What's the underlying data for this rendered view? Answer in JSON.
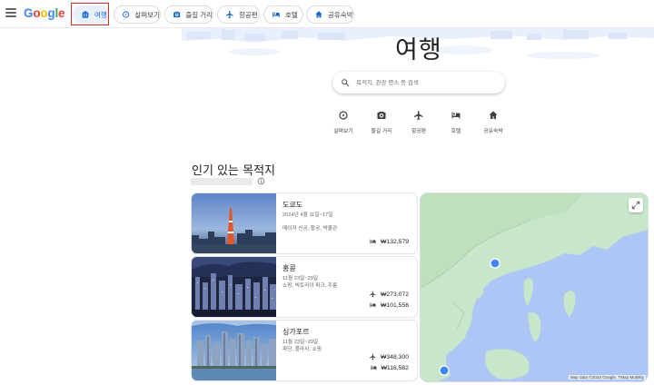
{
  "header": {
    "logo": [
      "G",
      "o",
      "o",
      "g",
      "l",
      "e"
    ],
    "tabs": [
      {
        "label": "여행",
        "icon": "suitcase-icon",
        "active": true
      },
      {
        "label": "살펴보기",
        "icon": "explore-icon",
        "active": false
      },
      {
        "label": "즐길 거리",
        "icon": "camera-icon",
        "active": false
      },
      {
        "label": "항공편",
        "icon": "flight-icon",
        "active": false
      },
      {
        "label": "호텔",
        "icon": "hotel-icon",
        "active": false
      },
      {
        "label": "공유숙박",
        "icon": "home-icon",
        "active": false
      }
    ]
  },
  "hero": {
    "title": "여행",
    "search_placeholder": "목적지, 관광 명소 등 검색",
    "quick_links": [
      {
        "label": "살펴보기",
        "icon": "explore-icon"
      },
      {
        "label": "즐길 거리",
        "icon": "camera-icon"
      },
      {
        "label": "항공편",
        "icon": "flight-icon"
      },
      {
        "label": "호텔",
        "icon": "hotel-icon"
      },
      {
        "label": "공유숙박",
        "icon": "home-icon"
      }
    ]
  },
  "section": {
    "title": "인기 있는 목적지"
  },
  "destinations": [
    {
      "name": "도쿄도",
      "dates": "2024년 4월 11일~17일",
      "tags": "메이지 신궁, 황궁, 박물관",
      "prices": [
        {
          "icon": "hotel-icon",
          "value": "₩132,579"
        }
      ]
    },
    {
      "name": "홍콩",
      "dates": "11월 23일~29일",
      "tags": "쇼핑, 빅토리아 피크, 주룽",
      "prices": [
        {
          "icon": "flight-icon",
          "value": "₩273,072"
        },
        {
          "icon": "hotel-icon",
          "value": "₩101,556"
        }
      ]
    },
    {
      "name": "싱가포르",
      "dates": "11월 23일~29일",
      "tags": "파당, 플라사, 쇼핑",
      "prices": [
        {
          "icon": "flight-icon",
          "value": "₩348,300"
        },
        {
          "icon": "hotel-icon",
          "value": "₩116,582"
        }
      ]
    }
  ],
  "map": {
    "attribution": "Map data ©2023 Google, TMap Mobility"
  },
  "colors": {
    "accent": "#1967d2",
    "active_chip_bg": "#e8f0fe",
    "highlight_frame": "#d93025",
    "map_water": "#aec6f5",
    "map_land": "#c8e6c9",
    "marker": "#4285f4"
  }
}
